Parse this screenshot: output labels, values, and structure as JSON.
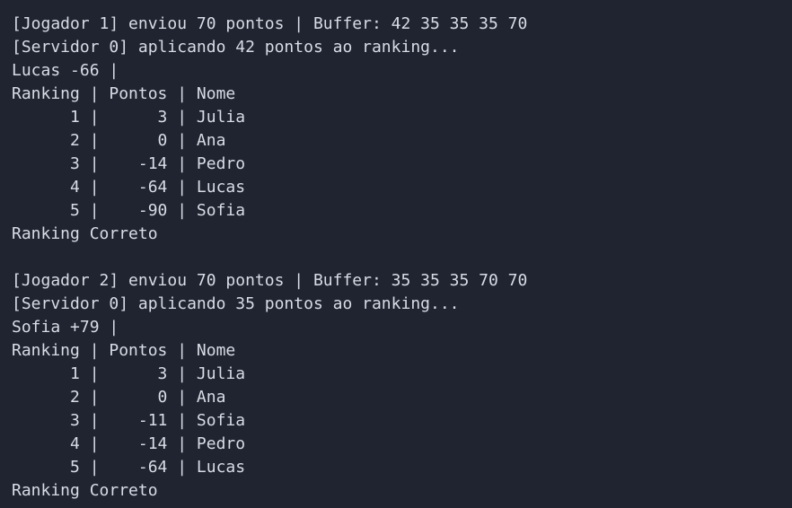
{
  "terminal": {
    "blocks": [
      {
        "send_line": "[Jogador 1] enviou 70 pontos | Buffer: 42 35 35 35 70",
        "apply_line": "[Servidor 0] aplicando 42 pontos ao ranking...",
        "update_line": "Lucas -66 |",
        "table_header": "Ranking | Pontos | Nome",
        "rows": [
          "      1 |      3 | Julia",
          "      2 |      0 | Ana",
          "      3 |    -14 | Pedro",
          "      4 |    -64 | Lucas",
          "      5 |    -90 | Sofia"
        ],
        "status_line": "Ranking Correto"
      },
      {
        "send_line": "[Jogador 2] enviou 70 pontos | Buffer: 35 35 35 70 70",
        "apply_line": "[Servidor 0] aplicando 35 pontos ao ranking...",
        "update_line": "Sofia +79 |",
        "table_header": "Ranking | Pontos | Nome",
        "rows": [
          "      1 |      3 | Julia",
          "      2 |      0 | Ana",
          "      3 |    -11 | Sofia",
          "      4 |    -14 | Pedro",
          "      5 |    -64 | Lucas"
        ],
        "status_line": "Ranking Correto"
      }
    ]
  }
}
